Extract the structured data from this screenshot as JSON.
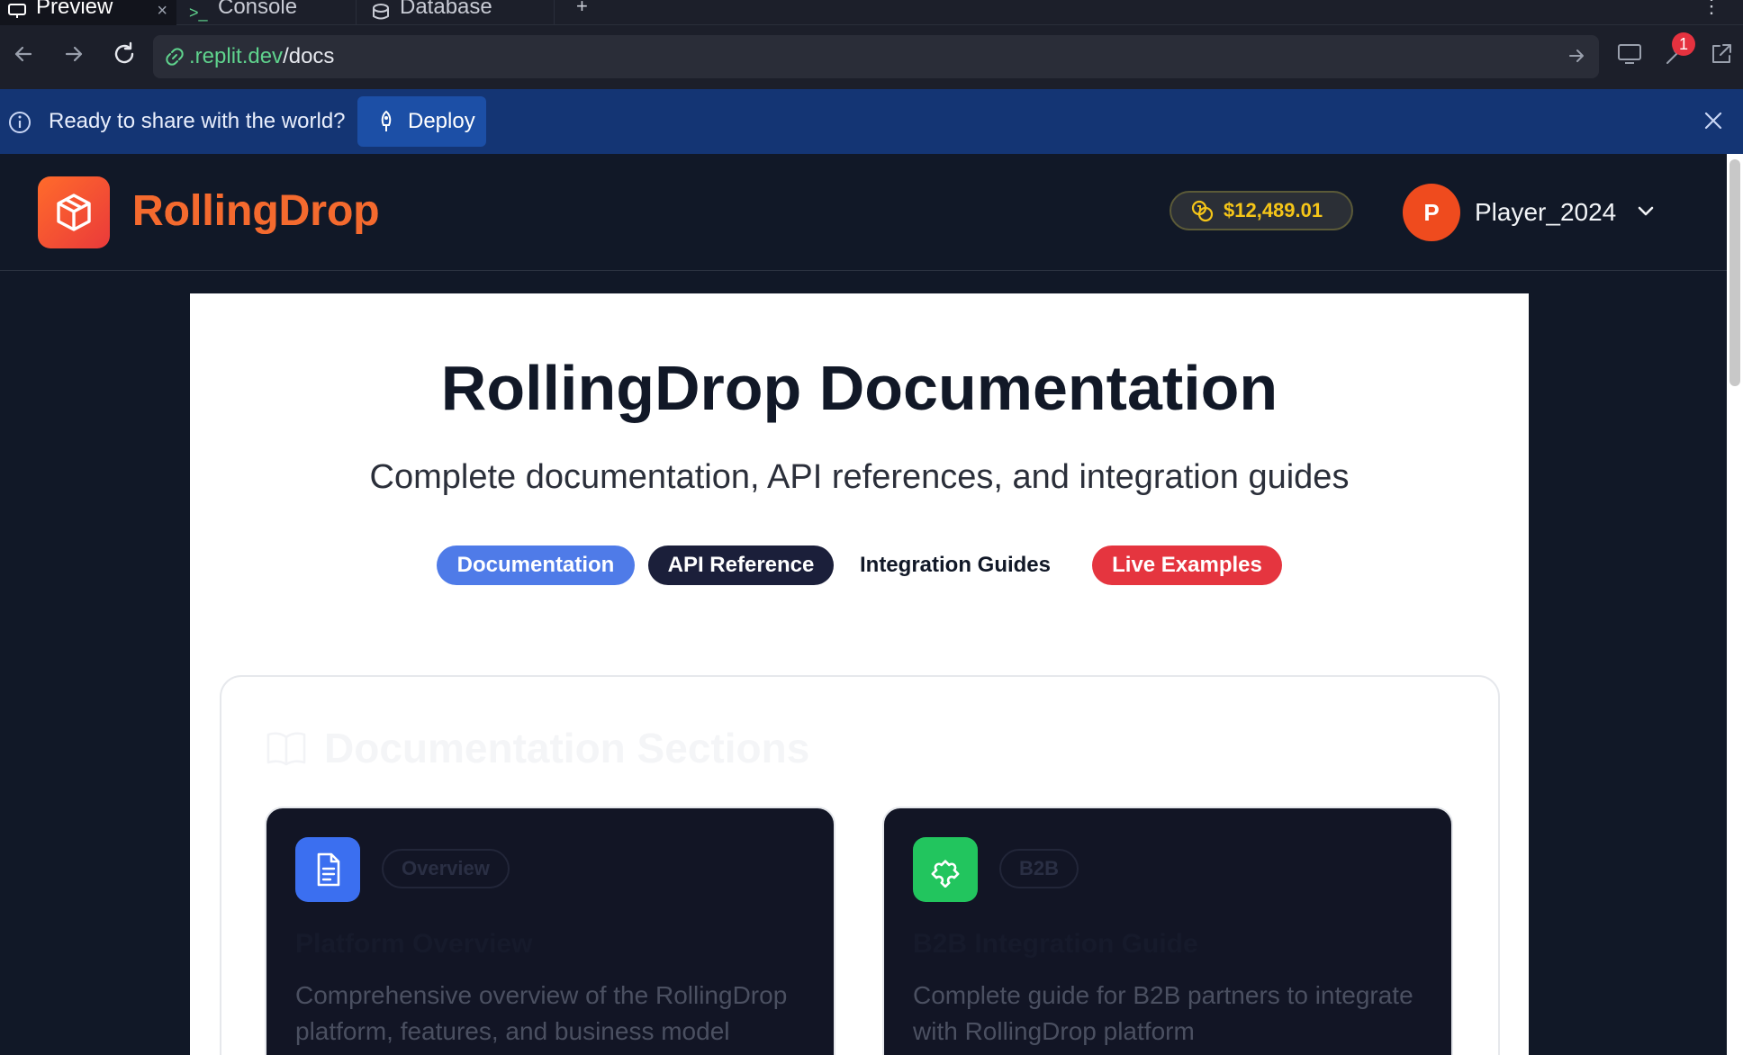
{
  "browser": {
    "tabs": [
      {
        "label": "Preview",
        "icon": "monitor-icon"
      },
      {
        "label": "Console",
        "icon": "terminal-icon"
      },
      {
        "label": "Database",
        "icon": "database-icon"
      }
    ],
    "tab_add": "+",
    "tab_more": "⋮",
    "url": {
      "host": ".replit.dev",
      "path": "/docs"
    },
    "notification_count": "1"
  },
  "infobar": {
    "message": "Ready to share with the world?",
    "deploy_label": "Deploy"
  },
  "site": {
    "brand": "RollingDrop",
    "balance": "$12,489.01",
    "avatar_initial": "P",
    "username": "Player_2024"
  },
  "docs": {
    "title": "RollingDrop Documentation",
    "subtitle": "Complete documentation, API references, and integration guides",
    "pills": [
      "Documentation",
      "API Reference",
      "Integration Guides",
      "Live Examples"
    ],
    "sections_title": "Documentation Sections",
    "sections": [
      {
        "tag": "Overview",
        "heading": "Platform Overview",
        "description": "Comprehensive overview of the RollingDrop platform, features, and business model",
        "icon": "document-icon",
        "color": "#3b6ff0"
      },
      {
        "tag": "B2B",
        "heading": "B2B Integration Guide",
        "description": "Complete guide for B2B partners to integrate with RollingDrop platform",
        "icon": "puzzle-icon",
        "color": "#22c55e"
      }
    ]
  },
  "colors": {
    "brand_orange": "#f46a2e",
    "info_blue": "#143574",
    "pill_docs": "#4f7be8",
    "pill_api": "#1b1f3a",
    "pill_live": "#e5353f",
    "balance_gold": "#f5c518"
  }
}
